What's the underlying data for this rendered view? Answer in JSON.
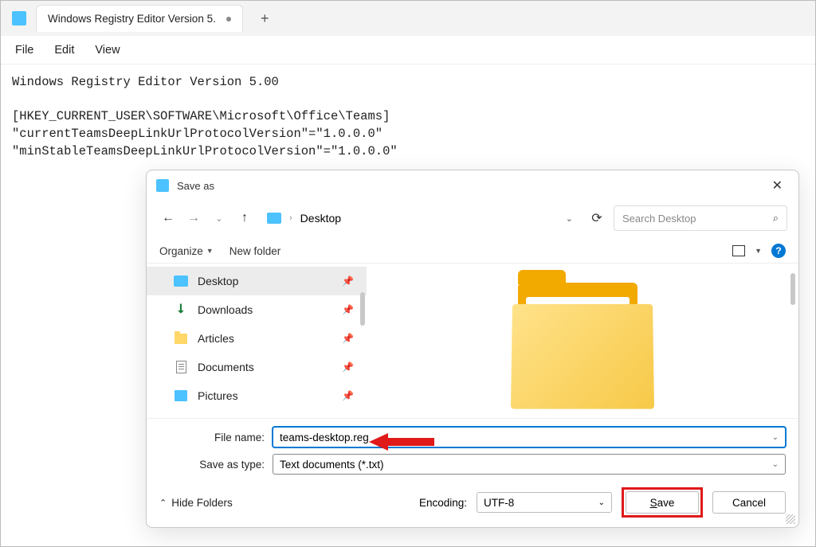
{
  "notepad": {
    "tab_title": "Windows Registry Editor Version 5.",
    "menus": {
      "file": "File",
      "edit": "Edit",
      "view": "View"
    },
    "content": "Windows Registry Editor Version 5.00\n\n[HKEY_CURRENT_USER\\SOFTWARE\\Microsoft\\Office\\Teams]\n\"currentTeamsDeepLinkUrlProtocolVersion\"=\"1.0.0.0\"\n\"minStableTeamsDeepLinkUrlProtocolVersion\"=\"1.0.0.0\""
  },
  "dialog": {
    "title": "Save as",
    "breadcrumb": "Desktop",
    "search_placeholder": "Search Desktop",
    "organize": "Organize",
    "new_folder": "New folder",
    "sidebar": [
      {
        "label": "Desktop",
        "icon": "monitor",
        "active": true
      },
      {
        "label": "Downloads",
        "icon": "download",
        "active": false
      },
      {
        "label": "Articles",
        "icon": "folder",
        "active": false
      },
      {
        "label": "Documents",
        "icon": "document",
        "active": false
      },
      {
        "label": "Pictures",
        "icon": "picture",
        "active": false
      }
    ],
    "file_name_label": "File name:",
    "file_name_value": "teams-desktop.reg",
    "save_type_label": "Save as type:",
    "save_type_value": "Text documents (*.txt)",
    "hide_folders": "Hide Folders",
    "encoding_label": "Encoding:",
    "encoding_value": "UTF-8",
    "save": "Save",
    "cancel": "Cancel"
  }
}
